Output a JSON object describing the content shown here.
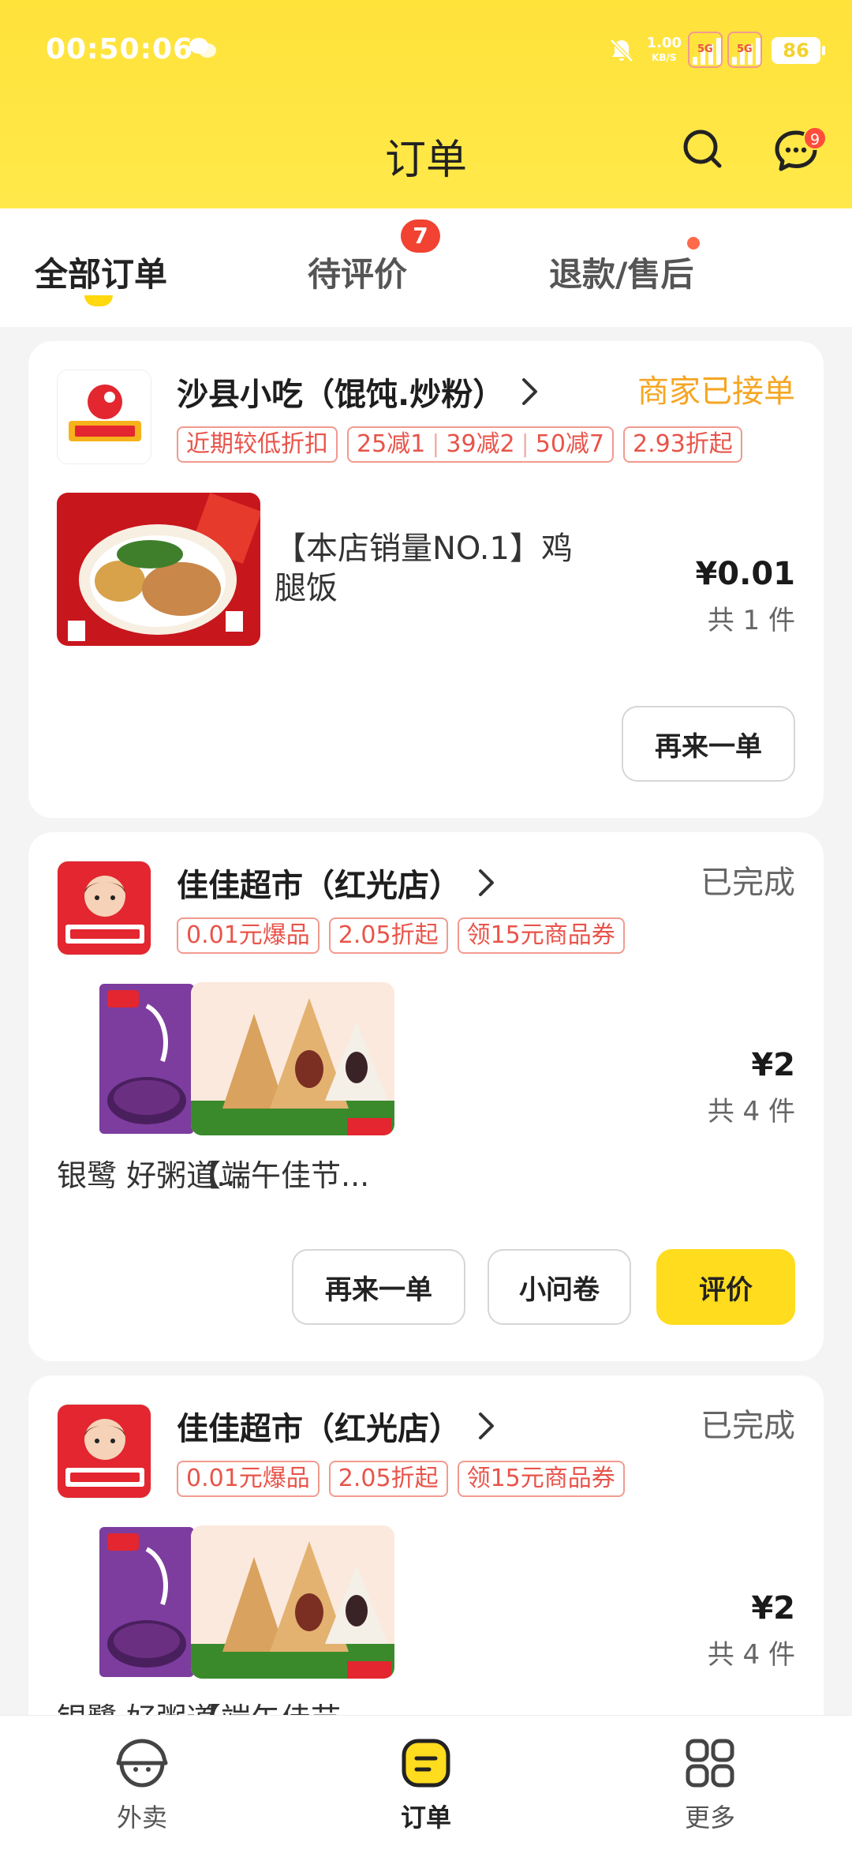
{
  "status_bar": {
    "time": "00:50:06",
    "net_speed": "1.00",
    "net_unit": "KB/S",
    "sim1": "5G",
    "sim2": "5G",
    "battery": "86"
  },
  "header": {
    "title": "订单",
    "msg_badge": "9"
  },
  "tabs": [
    {
      "label": "全部订单",
      "active": true
    },
    {
      "label": "待评价",
      "badge": "7"
    },
    {
      "label": "退款/售后",
      "dot": true
    }
  ],
  "orders": [
    {
      "shop": "沙县小吃（馄饨.炒粉）",
      "status": "商家已接单",
      "status_color": "#f5a623",
      "tags": [
        "近期较低折扣",
        "25减1",
        "39减2",
        "50减7",
        "2.93折起"
      ],
      "product_name": "【本店销量NO.1】鸡腿饭",
      "price": "¥0.01",
      "count": "共 1 件",
      "buttons": [
        "再来一单"
      ]
    },
    {
      "shop": "佳佳超市（红光店）",
      "status": "已完成",
      "status_color": "#666666",
      "tags": [
        "0.01元爆品",
        "2.05折起",
        "领15元商品券"
      ],
      "products": [
        "银鹭 好粥道...",
        "【端午佳节..."
      ],
      "price": "¥2",
      "count": "共 4 件",
      "buttons": [
        "再来一单",
        "小问卷",
        "评价"
      ]
    },
    {
      "shop": "佳佳超市（红光店）",
      "status": "已完成",
      "status_color": "#666666",
      "tags": [
        "0.01元爆品",
        "2.05折起",
        "领15元商品券"
      ],
      "products": [
        "银鹭 好粥道...",
        "【端午佳节..."
      ],
      "price": "¥2",
      "count": "共 4 件"
    }
  ],
  "bottom_nav": [
    {
      "label": "外卖",
      "icon": "takeout-icon"
    },
    {
      "label": "订单",
      "icon": "orders-icon",
      "active": true
    },
    {
      "label": "更多",
      "icon": "more-grid-icon"
    }
  ],
  "colors": {
    "brand_yellow": "#ffdc1e",
    "tag_red": "#e8544a",
    "badge_red": "#f14232"
  }
}
